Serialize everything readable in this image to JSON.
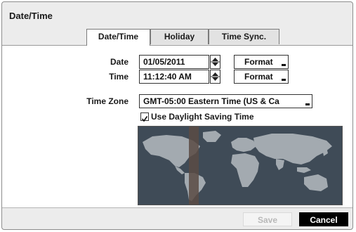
{
  "window": {
    "title": "Date/Time"
  },
  "tabs": [
    {
      "label": "Date/Time",
      "active": true
    },
    {
      "label": "Holiday",
      "active": false
    },
    {
      "label": "Time Sync.",
      "active": false
    }
  ],
  "date": {
    "label": "Date",
    "value": "01/05/2011",
    "format_label": "Format"
  },
  "time": {
    "label": "Time",
    "value": "11:12:40 AM",
    "format_label": "Format"
  },
  "timezone": {
    "label": "Time Zone",
    "value": "GMT-05:00  Eastern Time (US & Ca"
  },
  "dst": {
    "label": "Use Daylight Saving Time",
    "checked": true
  },
  "buttons": {
    "save": "Save",
    "cancel": "Cancel"
  },
  "colors": {
    "map_ocean": "#3f4b57",
    "map_land": "#a3aab0",
    "tz_band": "#5a4b44",
    "cancel_bg": "#000000"
  }
}
